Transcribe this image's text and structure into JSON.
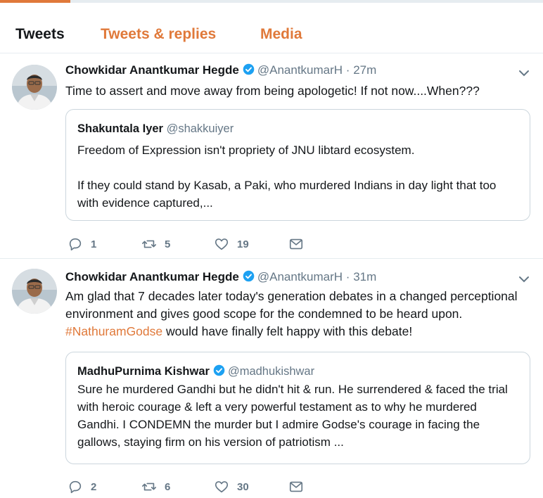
{
  "tabs": [
    {
      "label": "Tweets",
      "active": true
    },
    {
      "label": "Tweets & replies",
      "active": false
    },
    {
      "label": "Media",
      "active": false
    }
  ],
  "colors": {
    "accent": "#e0793a",
    "verified": "#1da1f2",
    "muted": "#657786"
  },
  "tweets": [
    {
      "author": "Chowkidar Anantkumar Hegde",
      "handle": "@AnantkumarH",
      "separator": "·",
      "time": "27m",
      "text": "Time to assert and move away from being apologetic!  If not now....When???",
      "quote": {
        "author": "Shakuntala Iyer",
        "handle": "@shakkuiyer",
        "para1": "Freedom of Expression isn't propriety of JNU libtard ecosystem.",
        "para2": "If they could stand by Kasab, a Paki, who murdered Indians in day light that too with evidence captured,..."
      },
      "replies": "1",
      "retweets": "5",
      "likes": "19"
    },
    {
      "author": "Chowkidar Anantkumar Hegde",
      "handle": "@AnantkumarH",
      "separator": "·",
      "time": "31m",
      "text_before": "Am glad that 7 decades later today's generation debates in a changed perceptional environment and gives good scope for the  condemned to be heard upon.  ",
      "hashtag": "#NathuramGodse",
      "text_after": " would have finally felt happy with this debate!",
      "quote": {
        "author": "MadhuPurnima Kishwar",
        "handle": "@madhukishwar",
        "para1": "Sure he murdered Gandhi but he didn't hit & run. He surrendered & faced the trial with heroic courage & left a very powerful testament as to why he murdered Gandhi. I CONDEMN the murder but I admire Godse's courage in facing the gallows, staying firm on his version of patriotism ..."
      },
      "replies": "2",
      "retweets": "6",
      "likes": "30"
    }
  ]
}
